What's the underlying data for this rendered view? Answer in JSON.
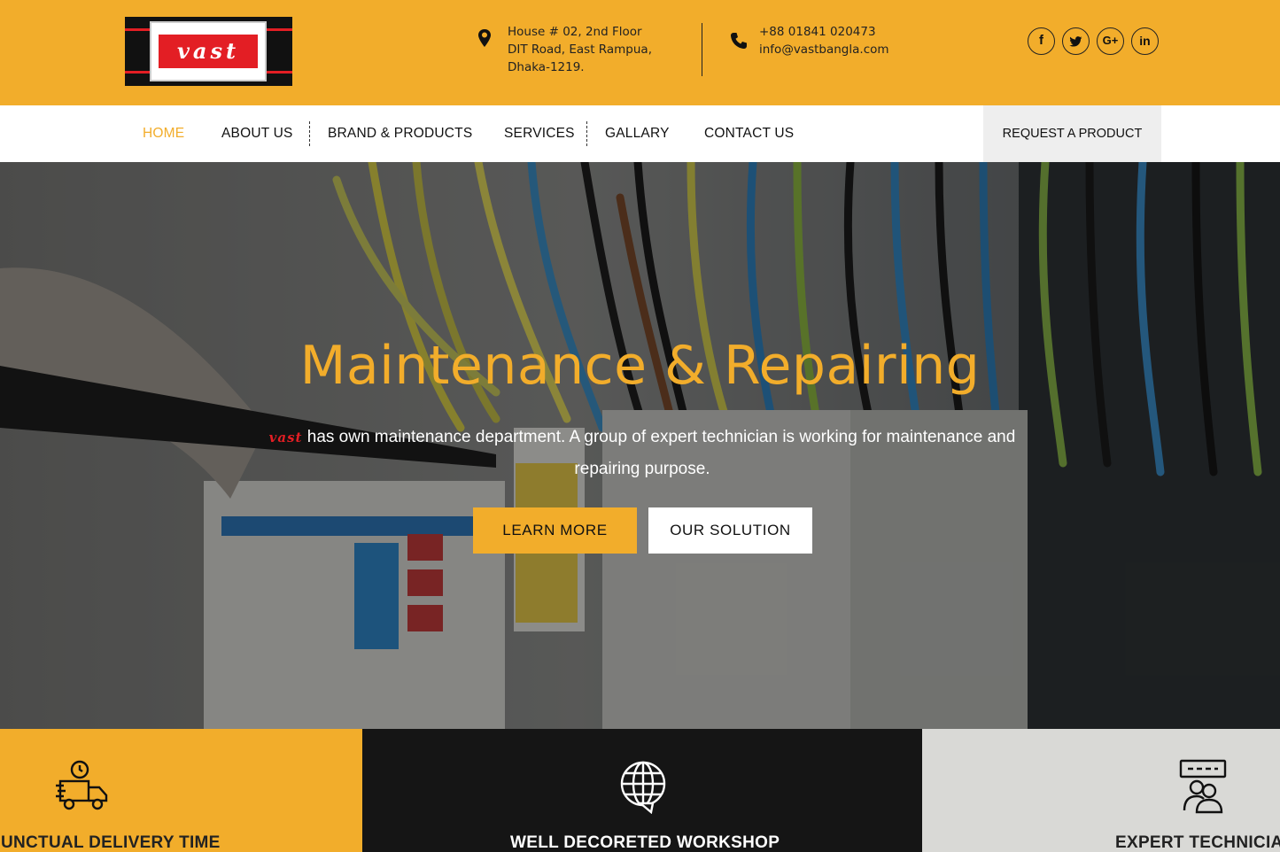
{
  "header": {
    "logo_text": "vast",
    "address_lines": [
      "House # 02, 2nd Floor",
      "DIT Road, East Rampua,",
      "Dhaka-1219."
    ],
    "phone": "+88 01841 020473",
    "email": "info@vastbangla.com",
    "socials": [
      {
        "icon": "facebook-icon",
        "glyph": "f"
      },
      {
        "icon": "twitter-icon",
        "glyph": "🐦"
      },
      {
        "icon": "google-plus-icon",
        "glyph": "G+"
      },
      {
        "icon": "linkedin-icon",
        "glyph": "in"
      }
    ]
  },
  "nav": {
    "items": [
      {
        "label": "HOME",
        "active": true
      },
      {
        "label": "ABOUT US",
        "active": false
      },
      {
        "label": "BRAND & PRODUCTS",
        "active": false
      },
      {
        "label": "SERVICES",
        "active": false
      },
      {
        "label": "GALLARY",
        "active": false
      },
      {
        "label": "CONTACT US",
        "active": false
      }
    ],
    "request_label": "REQUEST A PRODUCT"
  },
  "hero": {
    "title": "Maintenance & Repairing",
    "brand": "vast",
    "desc_line1": " has own maintenance department. A group of expert technician is working for maintenance and",
    "desc_line2": "repairing purpose.",
    "learn_more": "LEARN MORE",
    "our_solution": "OUR SOLUTION"
  },
  "features": [
    {
      "title": "PUNCTUAL DELIVERY TIME",
      "icon": "delivery-truck-icon"
    },
    {
      "title": "WELL DECORETED WORKSHOP",
      "icon": "globe-icon"
    },
    {
      "title": "EXPERT TECHNICIAN",
      "icon": "technicians-icon"
    }
  ],
  "colors": {
    "accent": "#f2ad2b",
    "brand_red": "#e31e24",
    "dark": "#151515"
  }
}
